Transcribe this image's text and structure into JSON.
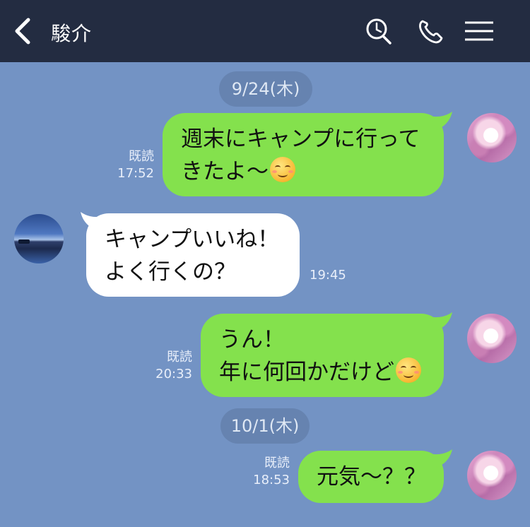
{
  "header": {
    "contact_name": "駿介",
    "icons": [
      "back-arrow-icon",
      "search-icon",
      "phone-icon",
      "menu-icon"
    ]
  },
  "colors": {
    "header_bg": "#232c41",
    "chat_bg": "#7393c4",
    "outgoing_bubble": "#84e14d",
    "incoming_bubble": "#ffffff"
  },
  "dates": [
    "9/24(木)",
    "10/1(木)"
  ],
  "messages": [
    {
      "direction": "outgoing",
      "lines": [
        "週末にキャンプに行って",
        "きたよ〜"
      ],
      "emoji": "relieved-face-icon",
      "read_label": "既読",
      "time": "17:52"
    },
    {
      "direction": "incoming",
      "lines": [
        "キャンプいいね！",
        "よく行くの？"
      ],
      "time": "19:45"
    },
    {
      "direction": "outgoing",
      "lines": [
        "うん！",
        "年に何回かだけど"
      ],
      "emoji": "relieved-face-icon",
      "read_label": "既読",
      "time": "20:33"
    },
    {
      "direction": "outgoing",
      "lines": [
        "元気〜？？"
      ],
      "read_label": "既読",
      "time": "18:53"
    }
  ]
}
